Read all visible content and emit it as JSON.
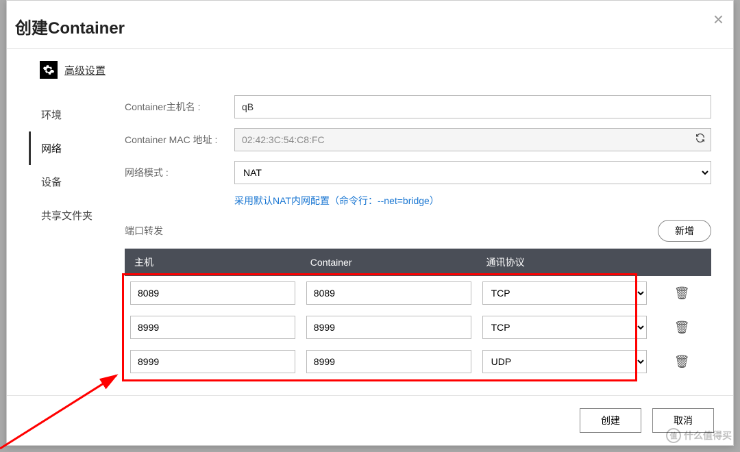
{
  "dialog": {
    "title": "创建Container",
    "advanced_label": "高级设置"
  },
  "sidebar": {
    "items": [
      {
        "label": "环境"
      },
      {
        "label": "网络"
      },
      {
        "label": "设备"
      },
      {
        "label": "共享文件夹"
      }
    ],
    "active_index": 1
  },
  "form": {
    "hostname_label": "Container主机名 :",
    "hostname_value": "qB",
    "mac_label": "Container MAC 地址 :",
    "mac_value": "02:42:3C:54:C8:FC",
    "mode_label": "网络模式 :",
    "mode_value": "NAT",
    "hint_text": "采用默认NAT内网配置（命令行：--net=bridge）"
  },
  "ports": {
    "section_label": "端口转发",
    "add_label": "新增",
    "headers": {
      "host": "主机",
      "container": "Container",
      "protocol": "通讯协议"
    },
    "rows": [
      {
        "host": "8089",
        "container": "8089",
        "protocol": "TCP"
      },
      {
        "host": "8999",
        "container": "8999",
        "protocol": "TCP"
      },
      {
        "host": "8999",
        "container": "8999",
        "protocol": "UDP"
      }
    ]
  },
  "footer": {
    "create": "创建",
    "cancel": "取消"
  },
  "watermark": "什么值得买"
}
